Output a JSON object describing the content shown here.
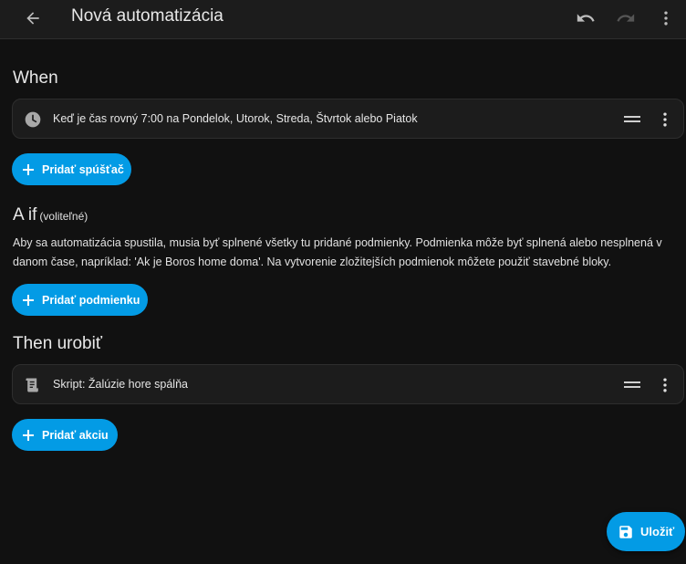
{
  "header": {
    "title": "Nová automatizácia"
  },
  "when": {
    "heading": "When",
    "trigger_text": "Keď je čas rovný 7:00 na Pondelok, Utorok, Streda, Štvrtok alebo Piatok",
    "add_label": "Pridať spúšťač"
  },
  "aif": {
    "heading": "A if",
    "optional": "(voliteľné)",
    "description": "Aby sa automatizácia spustila, musia byť splnené všetky tu pridané podmienky. Podmienka môže byť splnená alebo nesplnená v danom čase, napríklad: 'Ak je Boros home doma'. Na vytvorenie zložitejších podmienok môžete použiť stavebné bloky.",
    "add_label": "Pridať podmienku"
  },
  "then": {
    "heading": "Then urobiť",
    "action_text": "Skript: Žalúzie hore spálňa",
    "add_label": "Pridať akciu"
  },
  "fab": {
    "save_label": "Uložiť"
  },
  "colors": {
    "accent": "#039be5",
    "background": "#111111",
    "card": "#1c1c1c"
  },
  "icons": [
    "back-arrow-icon",
    "undo-icon",
    "redo-icon",
    "more-vert-icon",
    "clock-icon",
    "drag-handle-icon",
    "plus-icon",
    "script-icon",
    "save-icon"
  ]
}
